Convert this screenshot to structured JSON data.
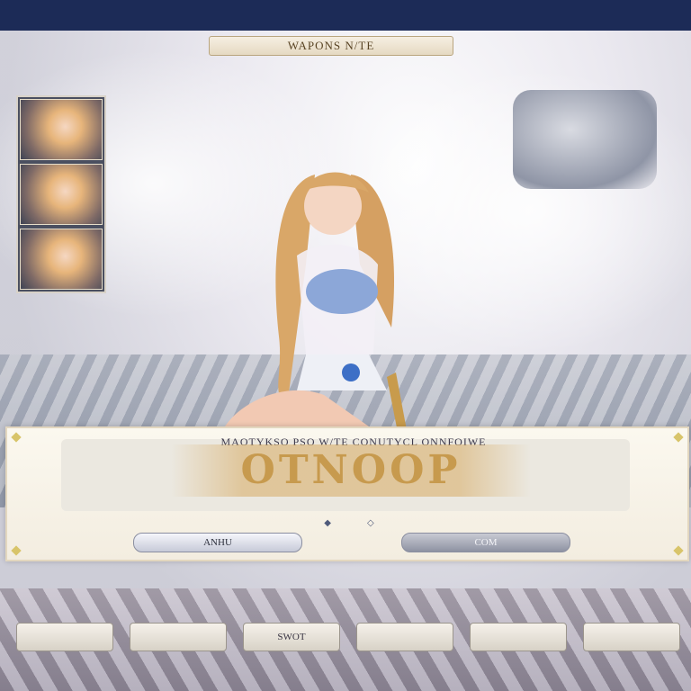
{
  "title_plate": "WAPONS N/TE",
  "panel": {
    "heading": "MAOTYKSO PSO W/TE CONUTYCL ONNFOIWE",
    "logo": "OTNOOP",
    "buttons": {
      "left": "ANHU",
      "right": "COM"
    }
  },
  "tabs": [
    {
      "label": ""
    },
    {
      "label": ""
    },
    {
      "label": "SWOT"
    },
    {
      "label": ""
    },
    {
      "label": ""
    },
    {
      "label": ""
    }
  ],
  "colors": {
    "topbar": "#1c2b57",
    "gold": "#c79a4e",
    "panel": "#fbf8ef"
  }
}
